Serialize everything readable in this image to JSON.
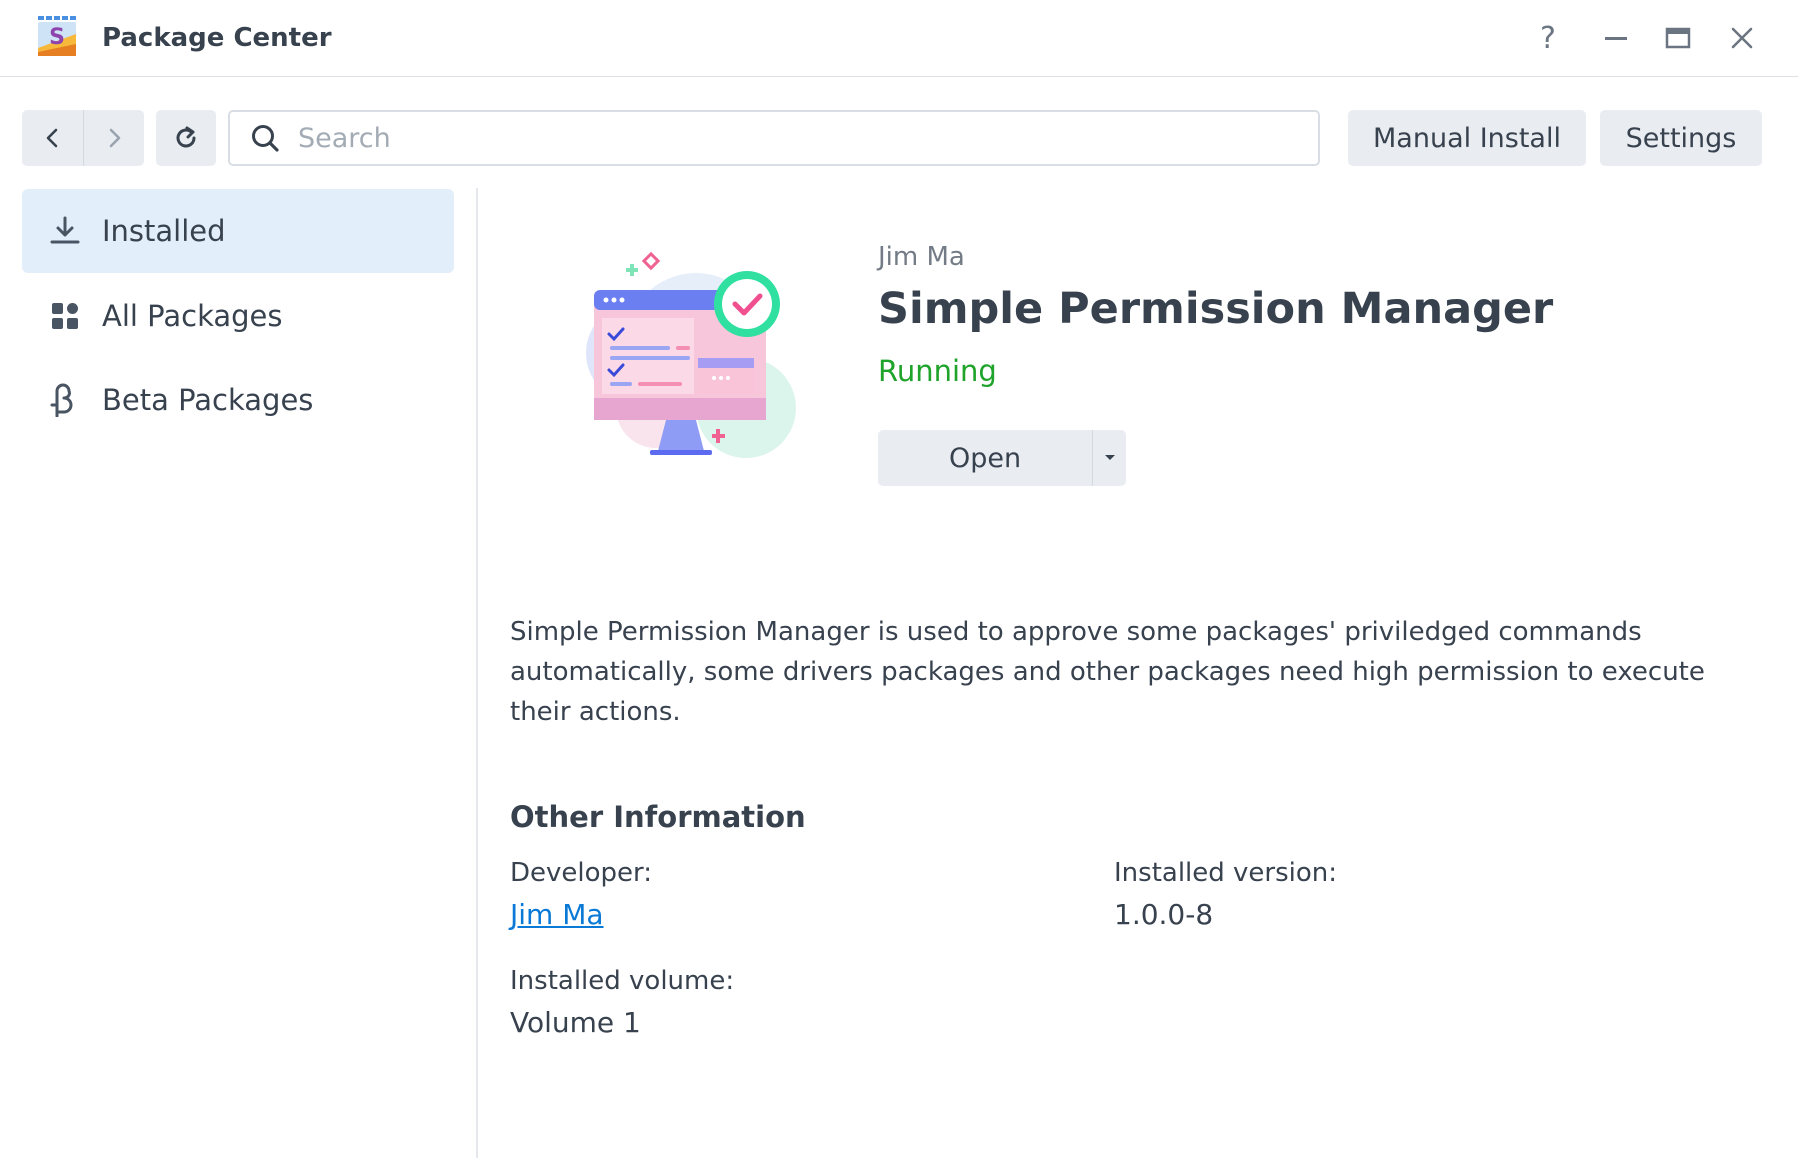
{
  "window": {
    "title": "Package Center"
  },
  "toolbar": {
    "search_placeholder": "Search",
    "manual_install_label": "Manual Install",
    "settings_label": "Settings"
  },
  "sidebar": {
    "items": [
      {
        "label": "Installed",
        "icon": "download-icon",
        "active": true
      },
      {
        "label": "All Packages",
        "icon": "grid-icon",
        "active": false
      },
      {
        "label": "Beta Packages",
        "icon": "beta-icon",
        "active": false
      }
    ]
  },
  "package": {
    "vendor": "Jim Ma",
    "name": "Simple Permission Manager",
    "status": "Running",
    "open_label": "Open",
    "description": "Simple Permission Manager is used to approve some packages' priviledged commands automatically, some drivers packages and other packages need high permission to execute their actions."
  },
  "other_info": {
    "heading": "Other Information",
    "developer_label": "Developer:",
    "developer_value": "Jim Ma",
    "installed_version_label": "Installed version:",
    "installed_version_value": "1.0.0-8",
    "installed_volume_label": "Installed volume:",
    "installed_volume_value": "Volume 1"
  },
  "colors": {
    "accent": "#0a7ad6",
    "status_running": "#1fa32a",
    "sidebar_active_bg": "#e3eefb",
    "button_bg": "#e9edf2"
  }
}
